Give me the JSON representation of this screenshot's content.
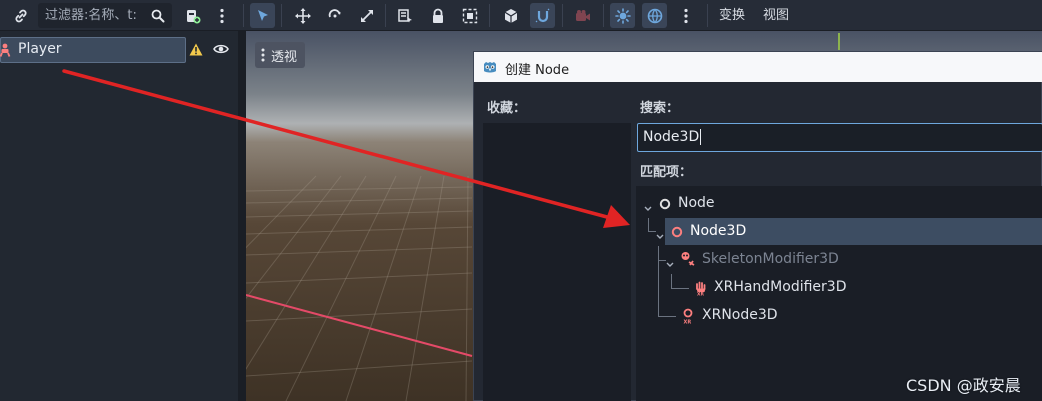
{
  "toolbar": {
    "filter_placeholder": "过滤器:名称、t:",
    "transform_menu": "变换",
    "view_menu": "视图"
  },
  "scene_tree": {
    "root_node": "Player"
  },
  "viewport": {
    "perspective_label": "透视"
  },
  "create_dialog": {
    "title": "创建 Node",
    "favorites_label": "收藏：",
    "search_label": "搜索：",
    "search_value": "Node3D",
    "matches_label": "匹配项：",
    "tree": [
      {
        "label": "Node"
      },
      {
        "label": "Node3D"
      },
      {
        "label": "SkeletonModifier3D"
      },
      {
        "label": "XRHandModifier3D"
      },
      {
        "label": "XRNode3D"
      }
    ]
  },
  "watermark": "CSDN @政安晨",
  "colors": {
    "accent": "#6ea7dd",
    "selection": "#3d4d62",
    "warning": "#f2c94c",
    "node3d_red": "#fc7f7f",
    "annotation_arrow": "#e02424"
  }
}
